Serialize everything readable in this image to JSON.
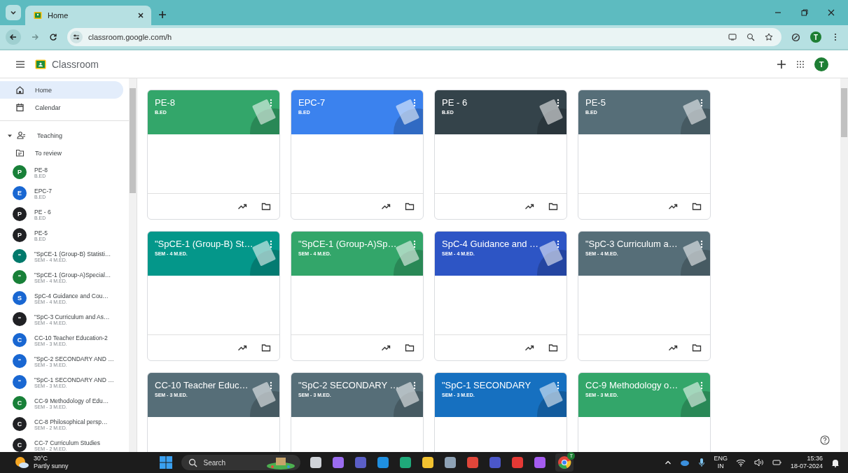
{
  "browser": {
    "tab_title": "Home",
    "url": "classroom.google.com/h",
    "profile_initial": "T"
  },
  "app": {
    "title": "Classroom",
    "avatar_initial": "T"
  },
  "sidebar": {
    "nav": [
      {
        "label": "Home",
        "selected": true
      },
      {
        "label": "Calendar",
        "selected": false
      }
    ],
    "teaching": {
      "label": "Teaching",
      "expanded": true
    },
    "to_review": "To review",
    "classes": [
      {
        "initial": "P",
        "name": "PE-8",
        "section": "B.ED",
        "color": "#188038"
      },
      {
        "initial": "E",
        "name": "EPC-7",
        "section": "B.ED",
        "color": "#1967d2"
      },
      {
        "initial": "P",
        "name": "PE - 6",
        "section": "B.ED",
        "color": "#202124"
      },
      {
        "initial": "P",
        "name": "PE-5",
        "section": "B.ED",
        "color": "#202124"
      },
      {
        "initial": "\"",
        "name": "\"SpCE-1 (Group-B) Statisti…",
        "section": "SEM - 4 M.ED.",
        "color": "#00796b"
      },
      {
        "initial": "\"",
        "name": "\"SpCE-1 (Group-A)Special…",
        "section": "SEM - 4 M.ED.",
        "color": "#188038"
      },
      {
        "initial": "S",
        "name": "SpC-4 Guidance and Cou…",
        "section": "SEM - 4 M.ED.",
        "color": "#1967d2"
      },
      {
        "initial": "\"",
        "name": "\"SpC-3 Curriculum and As…",
        "section": "SEM - 4 M.ED.",
        "color": "#202124"
      },
      {
        "initial": "C",
        "name": "CC-10 Teacher Education-2",
        "section": "SEM - 3 M.ED.",
        "color": "#1967d2"
      },
      {
        "initial": "\"",
        "name": "\"SpC-2 SECONDARY AND …",
        "section": "SEM - 3 M.ED.",
        "color": "#1967d2"
      },
      {
        "initial": "\"",
        "name": "\"SpC-1 SECONDARY AND …",
        "section": "SEM - 3 M.ED.",
        "color": "#1967d2"
      },
      {
        "initial": "C",
        "name": "CC-9 Methodology of Edu…",
        "section": "SEM - 3 M.ED.",
        "color": "#188038"
      },
      {
        "initial": "C",
        "name": "CC-8 Philosophical persp…",
        "section": "SEM - 2 M.ED.",
        "color": "#202124"
      },
      {
        "initial": "C",
        "name": "CC-7 Curriculum Studies",
        "section": "SEM - 2 M.ED.",
        "color": "#202124"
      }
    ]
  },
  "cards": [
    {
      "title": "PE-8",
      "section": "B.ED",
      "color": "#33a66a"
    },
    {
      "title": "EPC-7",
      "section": "B.ED",
      "color": "#3b82ee"
    },
    {
      "title": "PE - 6",
      "section": "B.ED",
      "color": "#34434a"
    },
    {
      "title": "PE-5",
      "section": "B.ED",
      "color": "#566e78"
    },
    {
      "title": "\"SpCE-1 (Group-B) St…",
      "section": "SEM - 4 M.ED.",
      "color": "#04978a"
    },
    {
      "title": "\"SpCE-1 (Group-A)Sp…",
      "section": "SEM - 4 M.ED.",
      "color": "#33a66a"
    },
    {
      "title": "SpC-4 Guidance and …",
      "section": "SEM - 4 M.ED.",
      "color": "#2d55c5"
    },
    {
      "title": "\"SpC-3 Curriculum a…",
      "section": "SEM - 4 M.ED.",
      "color": "#566e78"
    },
    {
      "title": "CC-10 Teacher Educ…",
      "section": "SEM - 3 M.ED.",
      "color": "#566e78"
    },
    {
      "title": "\"SpC-2 SECONDARY …",
      "section": "SEM - 3 M.ED.",
      "color": "#566e78"
    },
    {
      "title": "\"SpC-1 SECONDARY",
      "section": "SEM - 3 M.ED.",
      "color": "#1670c0"
    },
    {
      "title": "CC-9 Methodology o…",
      "section": "SEM - 3 M.ED.",
      "color": "#33a66a"
    }
  ],
  "taskbar": {
    "weather_temp": "30°C",
    "weather_text": "Partly sunny",
    "search_placeholder": "Search",
    "chrome_badge": "T",
    "language": "ENG",
    "region": "IN",
    "time": "15:36",
    "date": "18-07-2024"
  }
}
